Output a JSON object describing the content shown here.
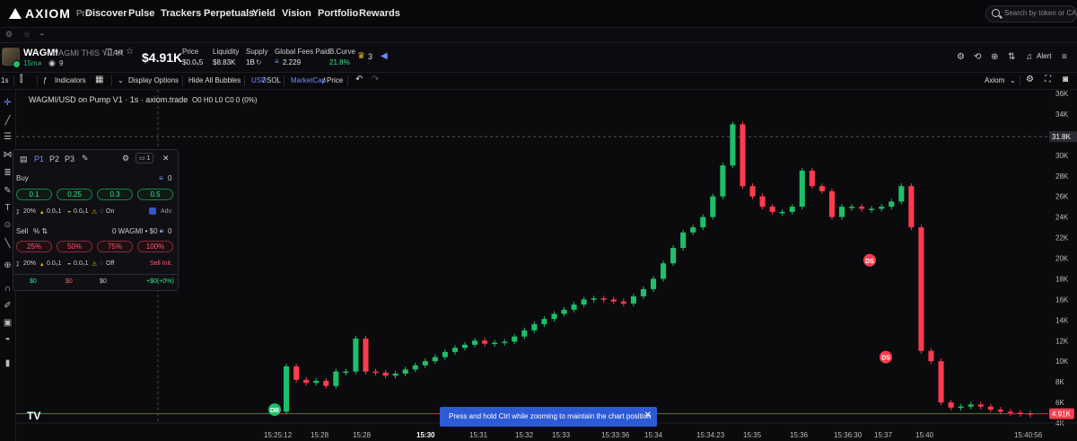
{
  "nav": {
    "brand": "AXIOM",
    "brand_suffix": "Pro",
    "links": [
      "Discover",
      "Pulse",
      "Trackers",
      "Perpetuals",
      "Yield",
      "Vision",
      "Portfolio",
      "Rewards"
    ],
    "search_placeholder": "Search by token or CA..."
  },
  "token": {
    "symbol": "WAGMI",
    "name": "WAGMI THIS YEAR",
    "age": "15m",
    "holders_icon_count": "9",
    "market_cap": "$4.91K",
    "stats": [
      {
        "label": "Price",
        "value": "$0.0₆5"
      },
      {
        "label": "Liquidity",
        "value": "$8.83K"
      },
      {
        "label": "Supply",
        "value": "1B"
      },
      {
        "label": "Global Fees Paid",
        "value": "2.229"
      },
      {
        "label": "B.Curve",
        "value": "21.8%"
      }
    ],
    "crown_count": "3",
    "alert_label": "Alert"
  },
  "toolbar": {
    "interval": "1s",
    "indicators": "Indicators",
    "display_options": "Display Options",
    "hide_bubbles": "Hide All Bubbles",
    "currency_a": "USD",
    "currency_b": "SOL",
    "mode_a": "MarketCap",
    "mode_b": "Price",
    "axiom_label": "Axiom"
  },
  "chart_legend": {
    "title": "WAGMI/USD on Pump V1 · 1s · axiom.trade",
    "ohlc": "O0 H0 L0 C0 0 (0%)"
  },
  "panel": {
    "tabs": [
      "P1",
      "P2",
      "P3"
    ],
    "wallets": "1",
    "buy_label": "Buy",
    "buy_balance": "0",
    "buy_amounts": [
      "0.1",
      "0.25",
      "0.3",
      "0.5"
    ],
    "buy_settings": [
      "20%",
      "0.0₀1",
      "0.0₀1",
      "On"
    ],
    "adv": "Adv.",
    "sell_label": "Sell",
    "sell_holdings": "0 WAGMI • $0 • ",
    "sell_balance": "0",
    "sell_amounts": [
      "25%",
      "50%",
      "75%",
      "100%"
    ],
    "sell_settings": [
      "20%",
      "0.0₀1",
      "0.0₀1",
      "Off"
    ],
    "sell_init": "Sell Init.",
    "footer": [
      "$0",
      "$0",
      "$0",
      "+$0(+0%)"
    ]
  },
  "chart_data": {
    "type": "candlestick",
    "y_axis_ticks": [
      "36K",
      "34K",
      "32K",
      "30K",
      "28K",
      "26K",
      "24K",
      "22K",
      "20K",
      "18K",
      "16K",
      "14K",
      "12K",
      "10K",
      "8K",
      "6K",
      "4K"
    ],
    "crosshair_y_label": "31.8K",
    "last_price_label": "4.91K",
    "x_axis_ticks": [
      "15:25:12",
      "15:28",
      "15:28",
      "15:30",
      "15:31",
      "15:32",
      "15:33",
      "15:33:36",
      "15:34",
      "15:34:23",
      "15:35",
      "15:36",
      "15:36:30",
      "15:37",
      "15:40",
      "15:40:56"
    ],
    "ylim": [
      3000,
      37000
    ],
    "markers": [
      {
        "label": "DB",
        "time_index": 0,
        "value": 5300,
        "color": "#1fbf6a"
      },
      {
        "label": "DS",
        "time_index": 1,
        "value": 19800,
        "color": "#ff3b4e"
      },
      {
        "label": "DS",
        "time_index": 2,
        "value": 10400,
        "color": "#ff3b4e"
      }
    ],
    "mcap_path_k": [
      5.1,
      9.5,
      8.2,
      7.9,
      8.1,
      7.6,
      9.0,
      9.0,
      12.2,
      9.0,
      8.9,
      8.6,
      8.8,
      9.2,
      9.6,
      10.0,
      10.4,
      10.9,
      11.3,
      11.6,
      12.0,
      11.7,
      11.8,
      11.9,
      12.4,
      13.0,
      13.6,
      14.1,
      14.6,
      15.0,
      15.5,
      16.0,
      16.1,
      16.0,
      15.8,
      15.6,
      16.3,
      17.0,
      18.0,
      19.5,
      21.0,
      22.5,
      23.0,
      24.0,
      26.0,
      29.0,
      33.0,
      27.0,
      26.0,
      25.0,
      24.5,
      24.5,
      25.0,
      28.5,
      27.0,
      26.5,
      24.0,
      25.0,
      25.0,
      24.8,
      24.8,
      25.0,
      25.5,
      27.0,
      23.0,
      11.0,
      10.0,
      6.0,
      5.5,
      5.6,
      5.8,
      5.6,
      5.3,
      5.1,
      5.0,
      4.95,
      4.91
    ]
  },
  "toast": {
    "message": "Press and hold Ctrl while zooming to maintain the chart position"
  }
}
